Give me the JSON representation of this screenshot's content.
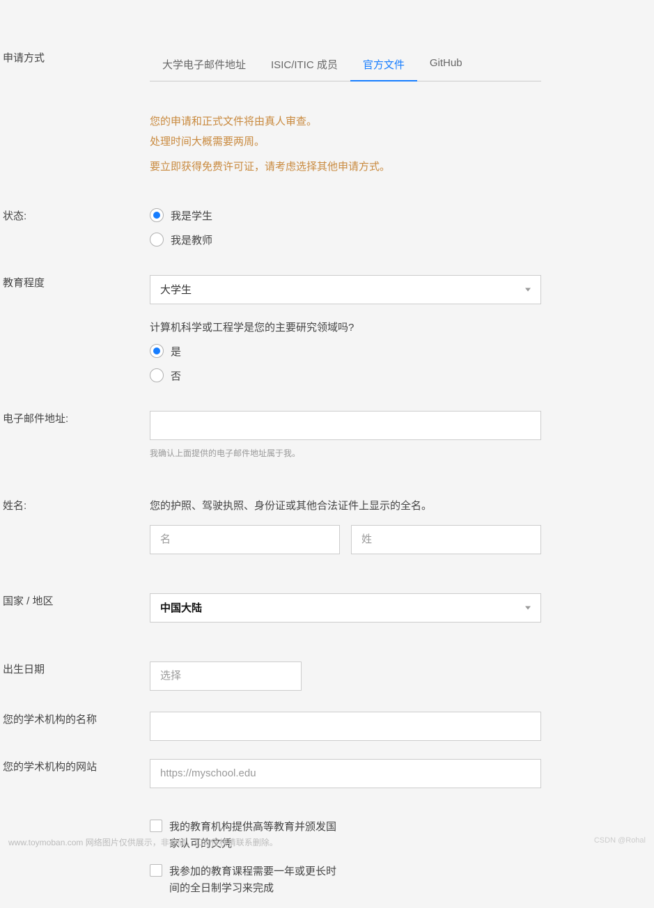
{
  "labels": {
    "application_method": "申请方式",
    "status": "状态:",
    "education_level": "教育程度",
    "email": "电子邮件地址:",
    "name": "姓名:",
    "country_region": "国家 / 地区",
    "birth_date": "出生日期",
    "institution_name": "您的学术机构的名称",
    "institution_website": "您的学术机构的网站"
  },
  "tabs": [
    {
      "label": "大学电子邮件地址",
      "active": false
    },
    {
      "label": "ISIC/ITIC 成员",
      "active": false
    },
    {
      "label": "官方文件",
      "active": true
    },
    {
      "label": "GitHub",
      "active": false
    }
  ],
  "notice": {
    "line1": "您的申请和正式文件将由真人审查。",
    "line2": "处理时间大概需要两周。",
    "line3": "要立即获得免费许可证，请考虑选择其他申请方式。"
  },
  "status_options": {
    "student": "我是学生",
    "teacher": "我是教师"
  },
  "education": {
    "selected": "大学生"
  },
  "cs_question": {
    "text": "计算机科学或工程学是您的主要研究领域吗?",
    "yes": "是",
    "no": "否"
  },
  "email_helper": "我确认上面提供的电子邮件地址属于我。",
  "name_section": {
    "hint": "您的护照、驾驶执照、身份证或其他合法证件上显示的全名。",
    "first_placeholder": "名",
    "last_placeholder": "姓"
  },
  "country": {
    "selected": "中国大陆"
  },
  "birth_date_placeholder": "选择",
  "website_placeholder": "https://myschool.edu",
  "checkboxes": {
    "higher_ed": "我的教育机构提供高等教育并颁发国家认可的文凭",
    "fulltime": "我参加的教育课程需要一年或更长时间的全日制学习来完成"
  },
  "footer": {
    "left": "www.toymoban.com 网络图片仅供展示，非存储，如有侵权请联系删除。",
    "right": "CSDN @Rohal"
  }
}
